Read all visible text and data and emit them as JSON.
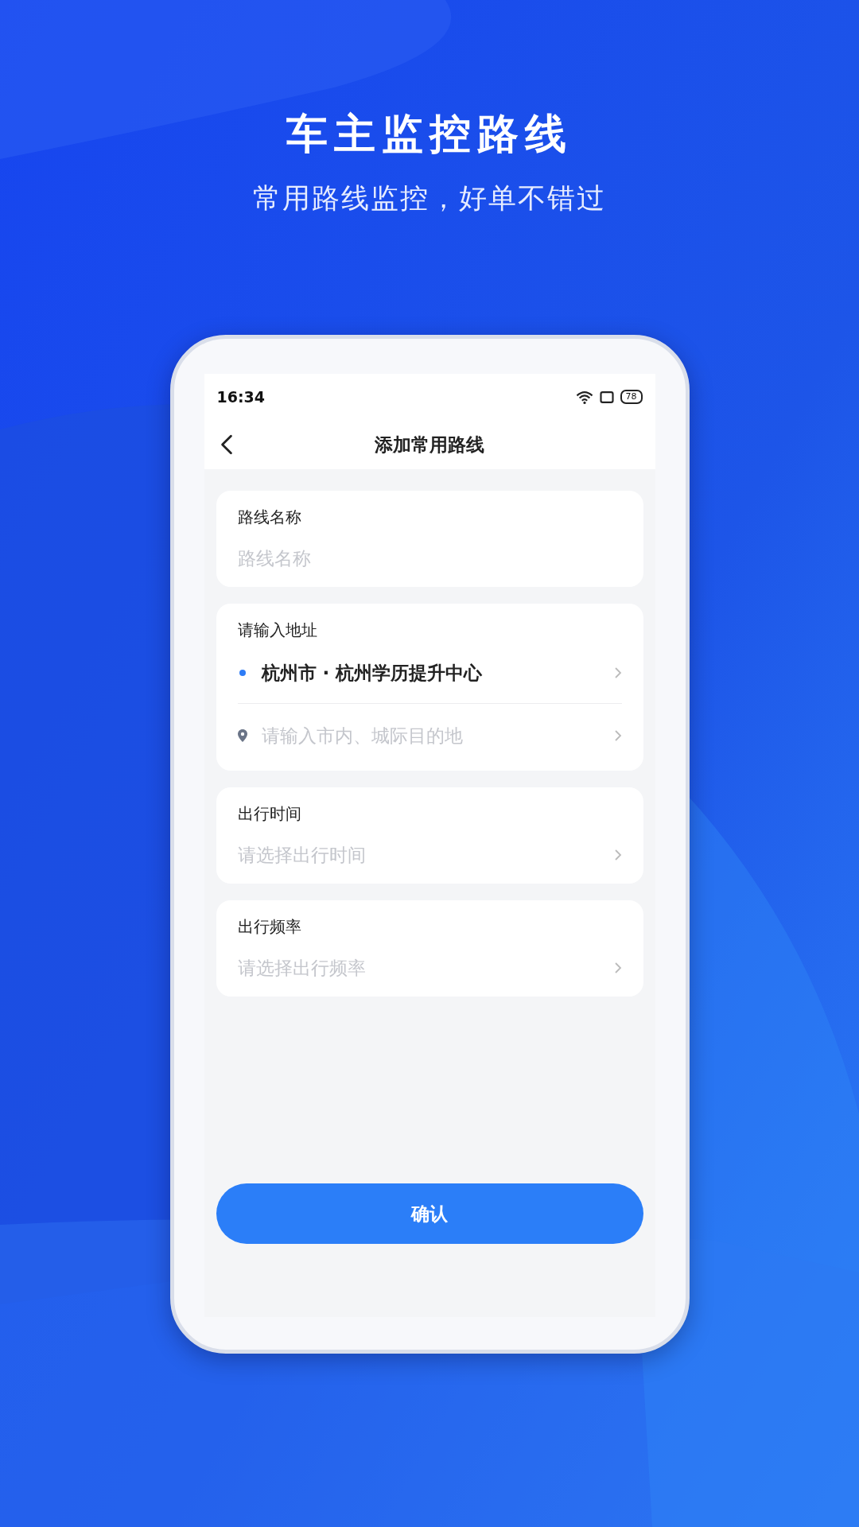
{
  "header": {
    "title": "车主监控路线",
    "subtitle": "常用路线监控，好单不错过"
  },
  "status_bar": {
    "time": "16:34",
    "battery": "78"
  },
  "nav": {
    "title": "添加常用路线"
  },
  "sections": [
    {
      "kind": "text",
      "label": "路线名称",
      "placeholder": "路线名称"
    },
    {
      "kind": "address",
      "label": "请输入地址",
      "stops": [
        {
          "kind": "start",
          "value": "杭州市 · 杭州学历提升中心"
        },
        {
          "kind": "destination",
          "placeholder": "请输入市内、城际目的地"
        }
      ]
    },
    {
      "kind": "select",
      "label": "出行时间",
      "placeholder": "请选择出行时间"
    },
    {
      "kind": "select",
      "label": "出行频率",
      "placeholder": "请选择出行频率"
    }
  ],
  "confirm_button": "确认"
}
